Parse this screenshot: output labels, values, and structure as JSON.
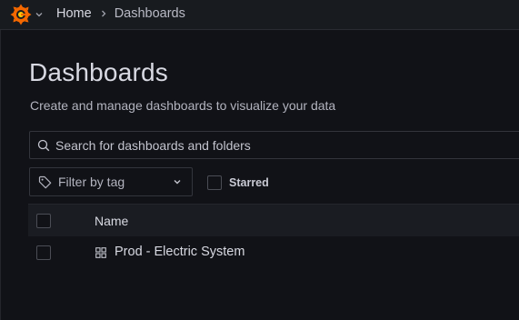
{
  "colors": {
    "background": "#111217",
    "topbar": "#181b1f",
    "brand_orange": "#f46800",
    "text_primary": "#d8d9e2",
    "text_secondary": "#b3b4bf",
    "border": "#33353c"
  },
  "topbar": {
    "logo_icon": "grafana-logo-icon",
    "menu_caret_icon": "chevron-down-icon"
  },
  "breadcrumb": {
    "home": "Home",
    "separator_icon": "chevron-right-icon",
    "current": "Dashboards"
  },
  "page": {
    "title": "Dashboards",
    "subtitle": "Create and manage dashboards to visualize your data"
  },
  "search": {
    "icon": "search-icon",
    "placeholder": "Search for dashboards and folders",
    "value": ""
  },
  "filters": {
    "tag_filter_label": "Filter by tag",
    "tag_icon": "tag-icon",
    "tag_chevron_icon": "chevron-down-icon",
    "starred_label": "Starred",
    "starred_checked": false
  },
  "table": {
    "columns": [
      "Name"
    ],
    "rows": [
      {
        "name": "Prod - Electric System",
        "icon": "dashboard-grid-icon",
        "checked": false
      }
    ]
  }
}
